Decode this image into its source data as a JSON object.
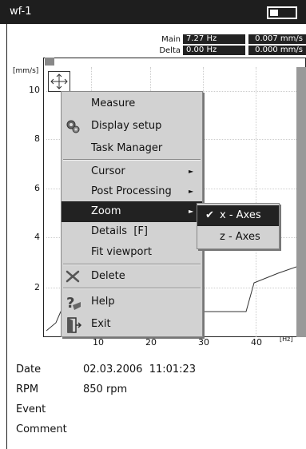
{
  "window": {
    "title": "wf-1"
  },
  "readouts": {
    "main": {
      "label": "Main",
      "freq": "7.27 Hz",
      "value": "0.007 mm/s"
    },
    "delta": {
      "label": "Delta",
      "freq": "0.00 Hz",
      "value": "0.000 mm/s"
    }
  },
  "plot": {
    "y_unit": "[mm/s]",
    "x_unit": "[Hz]",
    "y_ticks": [
      "10",
      "8",
      "6",
      "4",
      "2"
    ],
    "x_ticks": [
      "10",
      "20",
      "30",
      "40"
    ]
  },
  "context_menu": {
    "items": [
      {
        "label": "Measure",
        "icon": "none"
      },
      {
        "label": "Display setup",
        "icon": "gears-icon"
      },
      {
        "label": "Task Manager",
        "icon": "none"
      },
      {
        "label": "Cursor",
        "icon": "none",
        "submenu": true
      },
      {
        "label": "Post Processing",
        "icon": "none",
        "submenu": true
      },
      {
        "label": "Zoom",
        "icon": "none",
        "submenu": true,
        "selected": true
      },
      {
        "label": "Details  [F]",
        "icon": "none"
      },
      {
        "label": "Fit viewport",
        "icon": "none"
      },
      {
        "label": "Delete",
        "icon": "delete-icon"
      },
      {
        "label": "Help",
        "icon": "help-icon"
      },
      {
        "label": "Exit",
        "icon": "exit-icon"
      }
    ],
    "arrow_glyph": "►"
  },
  "zoom_submenu": {
    "items": [
      {
        "label": "x - Axes",
        "checked": true,
        "selected": true
      },
      {
        "label": "z - Axes",
        "checked": false,
        "selected": false
      }
    ],
    "check_glyph": "✔"
  },
  "info": {
    "date_label": "Date",
    "date_value": "02.03.2006  11:01:23",
    "rpm_label": "RPM",
    "rpm_value": "850 rpm",
    "event_label": "Event",
    "comment_label": "Comment"
  }
}
